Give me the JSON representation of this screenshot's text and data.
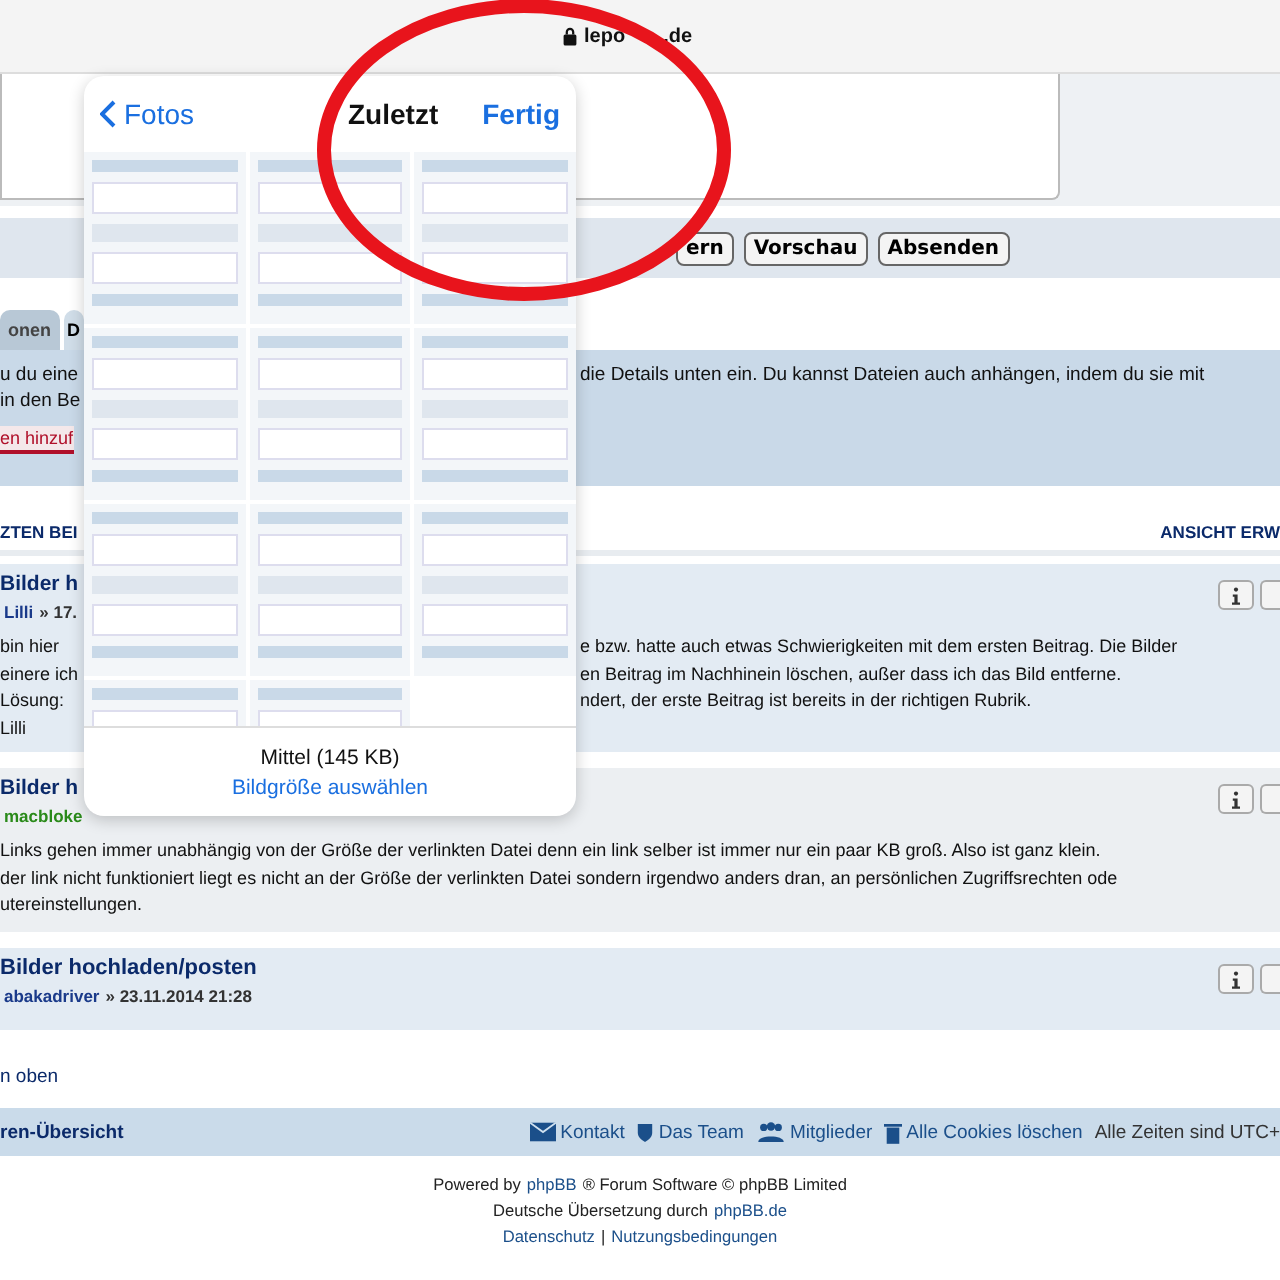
{
  "browser": {
    "address_parts": [
      "lepo",
      ".de"
    ]
  },
  "editor_buttons": [
    {
      "label": "ern"
    },
    {
      "label": "Vorschau"
    },
    {
      "label": "Absenden"
    }
  ],
  "tabs": [
    {
      "label": "onen",
      "selected": false
    },
    {
      "label": "D",
      "selected": true
    }
  ],
  "info_panel": {
    "lines": [
      {
        "left": "u du eine",
        "right": "die Details unten ein. Du kannst Dateien auch anhängen, indem du sie mit"
      },
      {
        "left": "in den Be"
      }
    ],
    "add_button": "en hinzuf"
  },
  "section_header": {
    "left": "ZTEN BEI",
    "right": "ANSICHT ERW"
  },
  "posts": [
    {
      "title": "Bilder h",
      "author": "Lilli",
      "color": "#1a3a8a",
      "meta": "» 17.",
      "lines": [
        {
          "left": "bin hier",
          "right": "e bzw. hatte auch etwas Schwierigkeiten mit dem ersten Beitrag. Die Bilder"
        },
        {
          "left": "einere ich",
          "right": "en Beitrag im Nachhinein löschen, außer dass ich das Bild entferne."
        },
        {
          "left": "Lösung:",
          "right": "ndert, der erste Beitrag ist bereits in der richtigen Rubrik."
        },
        {
          "left": "Lilli"
        }
      ]
    },
    {
      "title": "Bilder h",
      "author": "macbloke",
      "color": "#2a8a1a",
      "lines": [
        {
          "left": "Links gehen immer unabhängig von der Größe der verlinkten Datei denn ein link selber ist immer nur ein paar KB groß. Also ist ganz klein."
        },
        {
          "left": "der link nicht funktioniert liegt es nicht an der Größe der verlinkten Datei sondern irgendwo anders dran, an persönlichen Zugriffsrechten ode"
        },
        {
          "left": "utereinstellungen."
        }
      ]
    },
    {
      "title": "Bilder hochladen/posten",
      "author": "abakadriver",
      "color": "#1a3a8a",
      "meta": "» 23.11.2014 21:28"
    }
  ],
  "top_link": "n oben",
  "footer_bar": {
    "left": "ren-Übersicht",
    "links": [
      {
        "kind": "mail",
        "label": "Kontakt"
      },
      {
        "kind": "shield",
        "label": "Das Team"
      },
      {
        "kind": "people",
        "label": "Mitglieder"
      },
      {
        "kind": "trash",
        "label": "Alle Cookies löschen"
      }
    ],
    "timezone": "Alle Zeiten sind UTC+"
  },
  "credits": {
    "line1_prefix": "Powered by",
    "line1_link": "phpBB",
    "line1_suffix": "® Forum Software © phpBB Limited",
    "line2_prefix": "Deutsche Übersetzung durch",
    "line2_link": "phpBB.de",
    "links": [
      "Datenschutz",
      "Nutzungsbedingungen"
    ],
    "separator": "|"
  },
  "photo_picker": {
    "back": "Fotos",
    "title": "Zuletzt",
    "done": "Fertig",
    "size": "Mittel (145 KB)",
    "size_link": "Bildgröße auswählen"
  }
}
